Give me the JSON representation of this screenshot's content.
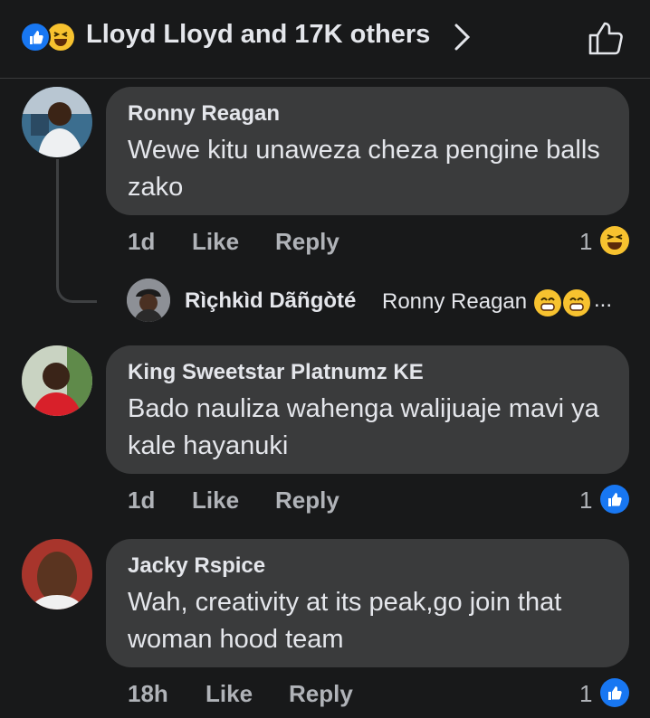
{
  "header": {
    "reactions_text": "Lloyd Lloyd and 17K others",
    "reaction_icons": [
      "like-icon",
      "haha-icon"
    ]
  },
  "comments": [
    {
      "author": "Ronny Reagan",
      "text": "Wewe kitu unaweza cheza pengine balls zako",
      "time": "1d",
      "like_label": "Like",
      "reply_label": "Reply",
      "reaction_count": "1",
      "reaction_icon": "haha-icon",
      "reply_preview": {
        "author": "Rìçhkìd Dãñgòté",
        "snippet": "Ronny Reagan",
        "emojis": [
          "grin-icon",
          "grin-icon"
        ],
        "ellipsis": "..."
      }
    },
    {
      "author": "King Sweetstar Platnumz KE",
      "text": "Bado nauliza wahenga walijuaje mavi ya kale hayanuki",
      "time": "1d",
      "like_label": "Like",
      "reply_label": "Reply",
      "reaction_count": "1",
      "reaction_icon": "like-icon"
    },
    {
      "author": "Jacky Rspice",
      "text": "Wah, creativity at its peak,go join that woman hood team",
      "time": "18h",
      "like_label": "Like",
      "reply_label": "Reply",
      "reaction_count": "1",
      "reaction_icon": "like-icon"
    }
  ],
  "colors": {
    "background": "#18191a",
    "bubble": "#3a3b3c",
    "primary_text": "#e4e6eb",
    "secondary_text": "#b0b3b8",
    "like_blue": "#1877f2",
    "haha_yellow": "#f7c22f"
  }
}
